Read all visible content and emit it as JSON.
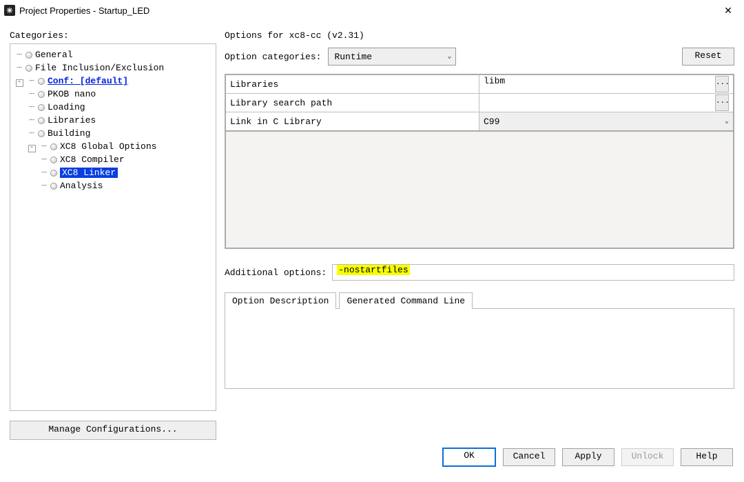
{
  "window": {
    "title": "Project Properties - Startup_LED",
    "close_glyph": "✕"
  },
  "left": {
    "categories_label": "Categories:",
    "tree": {
      "general": "General",
      "file_inclusion": "File Inclusion/Exclusion",
      "conf_default": "Conf: [default]",
      "pkob_nano": "PKOB nano",
      "loading": "Loading",
      "libraries": "Libraries",
      "building": "Building",
      "xc8_global": "XC8 Global Options",
      "xc8_compiler": "XC8 Compiler",
      "xc8_linker": "XC8 Linker",
      "analysis": "Analysis"
    },
    "manage_button": "Manage Configurations..."
  },
  "right": {
    "options_for": "Options for xc8-cc (v2.31)",
    "option_categories_label": "Option categories:",
    "option_categories_value": "Runtime",
    "reset": "Reset",
    "rows": {
      "libraries_label": "Libraries",
      "libraries_value": "libm",
      "lib_search_label": "Library search path",
      "lib_search_value": "",
      "link_c_label": "Link in C Library",
      "link_c_value": "C99"
    },
    "additional_label": "Additional options:",
    "additional_value": "-nostartfiles",
    "tab_desc": "Option Description",
    "tab_cmd": "Generated Command Line"
  },
  "footer": {
    "ok": "OK",
    "cancel": "Cancel",
    "apply": "Apply",
    "unlock": "Unlock",
    "help": "Help"
  }
}
